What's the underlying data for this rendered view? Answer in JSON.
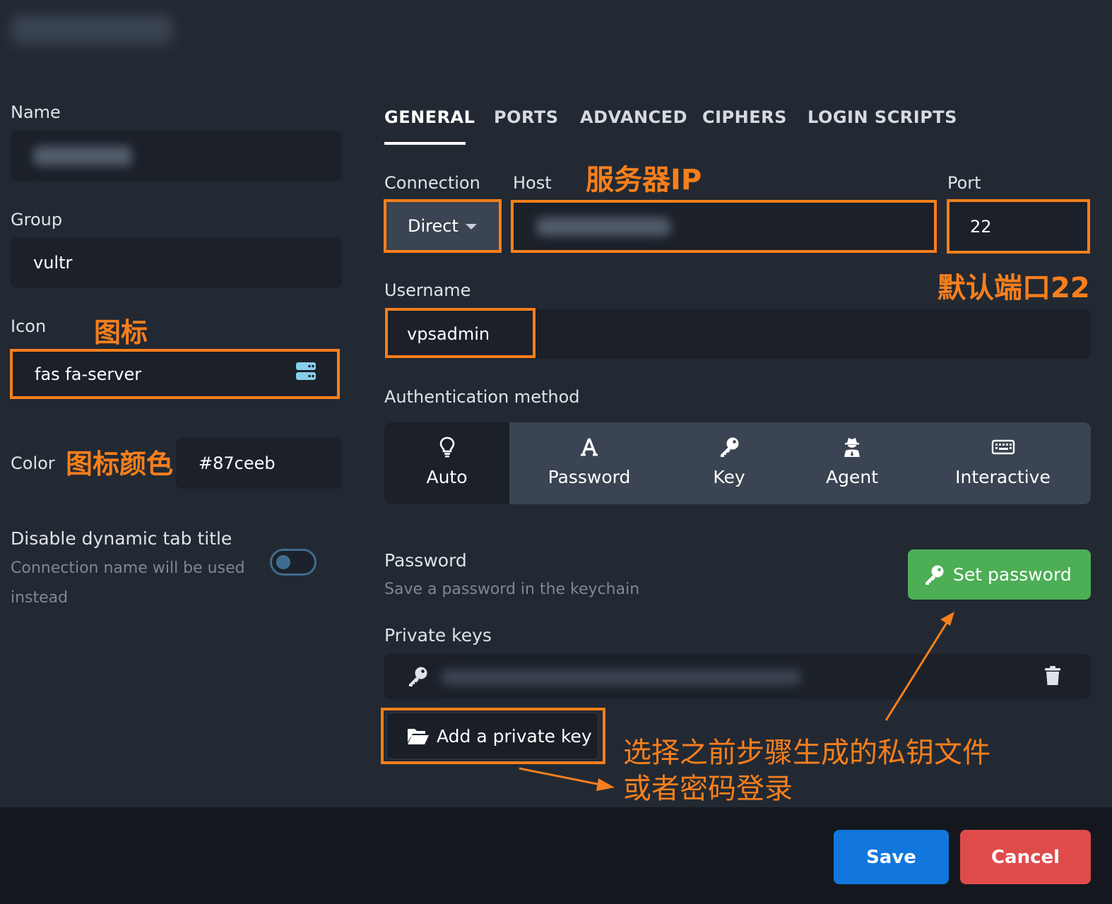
{
  "left": {
    "name_label": "Name",
    "group_label": "Group",
    "group_value": "vultr",
    "icon_label": "Icon",
    "icon_value": "fas fa-server",
    "color_label": "Color",
    "color_value": "#87ceeb",
    "dyn_title_label": "Disable dynamic tab title",
    "dyn_title_sub_line1": "Connection name will be used",
    "dyn_title_sub_line2": "instead",
    "dyn_title_enabled": false
  },
  "tabs": [
    {
      "label": "GENERAL",
      "active": true
    },
    {
      "label": "PORTS",
      "active": false
    },
    {
      "label": "ADVANCED",
      "active": false
    },
    {
      "label": "CIPHERS",
      "active": false
    },
    {
      "label": "LOGIN SCRIPTS",
      "active": false
    }
  ],
  "general": {
    "connection_label": "Connection",
    "connection_value": "Direct",
    "host_label": "Host",
    "port_label": "Port",
    "port_value": "22",
    "username_label": "Username",
    "username_value": "vpsadmin",
    "auth_label": "Authentication method",
    "auth_options": [
      {
        "label": "Auto",
        "icon": "lightbulb-icon",
        "selected": true
      },
      {
        "label": "Password",
        "icon": "font-a-icon",
        "selected": false
      },
      {
        "label": "Key",
        "icon": "key-icon",
        "selected": false
      },
      {
        "label": "Agent",
        "icon": "user-secret-icon",
        "selected": false
      },
      {
        "label": "Interactive",
        "icon": "keyboard-icon",
        "selected": false
      }
    ],
    "password_label": "Password",
    "password_sub": "Save a password in the keychain",
    "set_password_label": "Set password",
    "private_keys_label": "Private keys",
    "add_key_label": "Add a private key"
  },
  "footer": {
    "save_label": "Save",
    "cancel_label": "Cancel"
  },
  "annotations": {
    "server_ip": "服务器IP",
    "default_port": "默认端口22",
    "icon": "图标",
    "icon_color": "图标颜色",
    "key_hint_line1": "选择之前步骤生成的私钥文件",
    "key_hint_line2": "或者密码登录"
  },
  "colors": {
    "background": "#222933",
    "field": "#1b2029",
    "annotation": "#f77f1c",
    "icon_color": "#87ceeb",
    "set_password": "#4cae55",
    "save": "#1177dd",
    "cancel": "#df4b4b"
  }
}
